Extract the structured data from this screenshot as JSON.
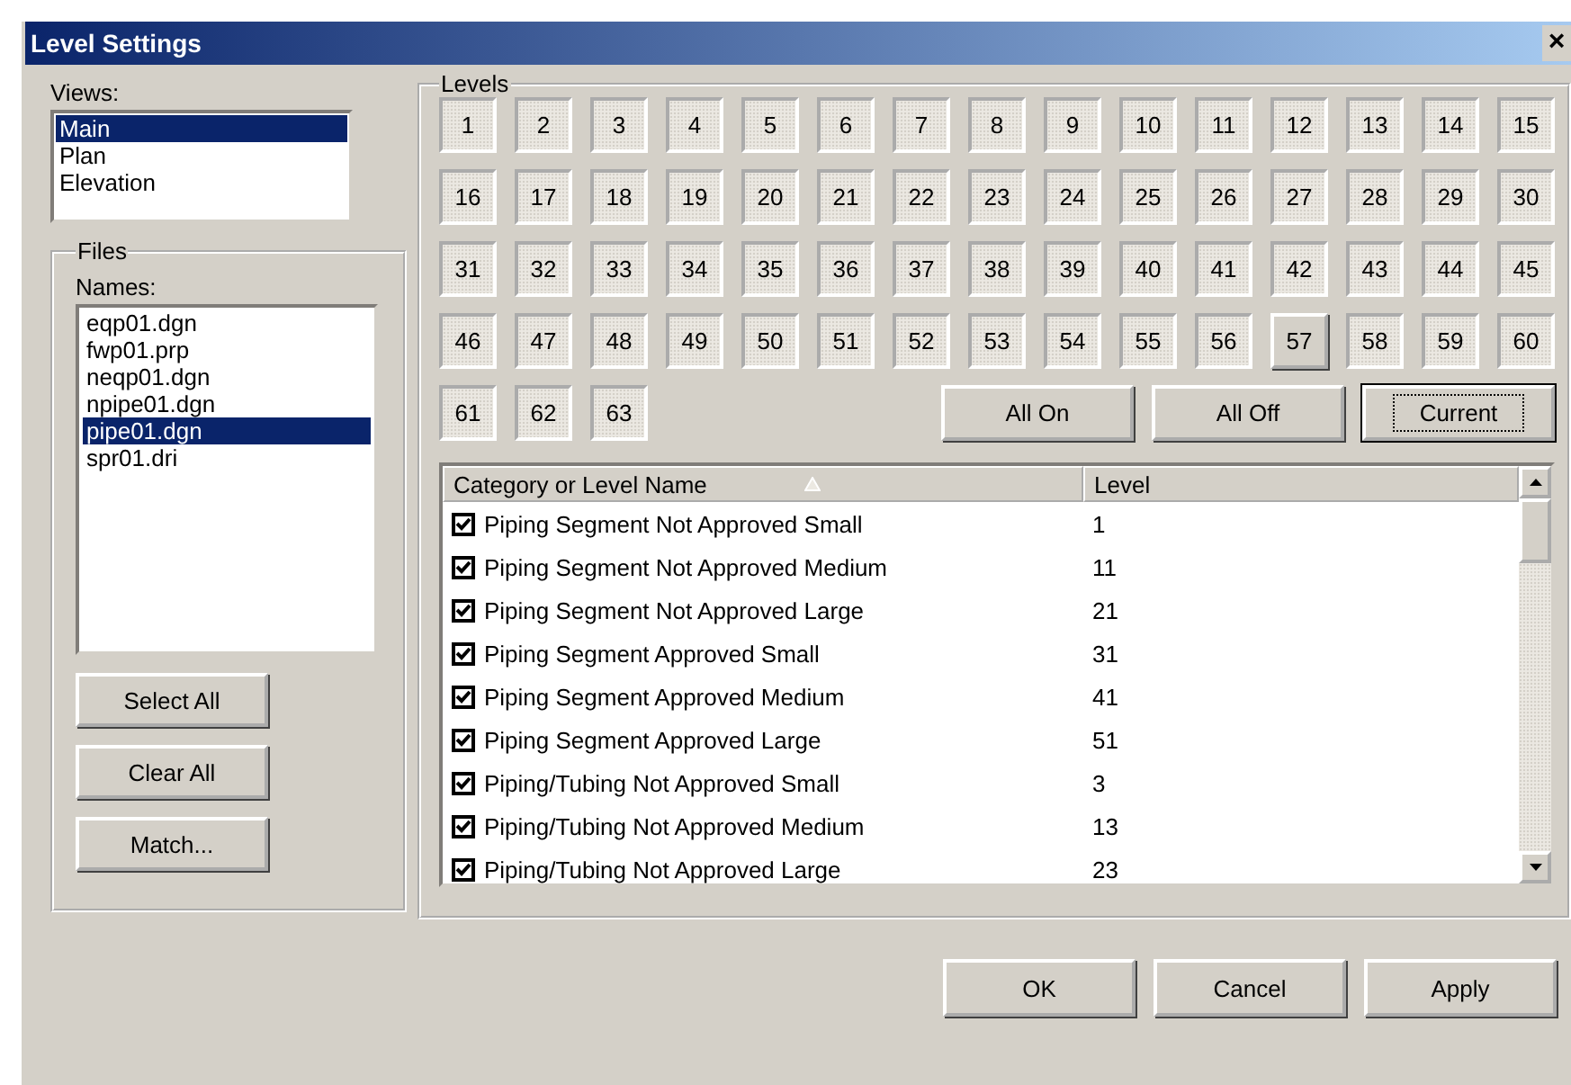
{
  "window": {
    "title": "Level Settings",
    "close": "×"
  },
  "views": {
    "label": "Views:",
    "items": [
      {
        "name": "Main",
        "selected": true
      },
      {
        "name": "Plan",
        "selected": false
      },
      {
        "name": "Elevation",
        "selected": false
      }
    ]
  },
  "files": {
    "title": "Files",
    "label": "Names:",
    "items": [
      {
        "name": "eqp01.dgn",
        "selected": false
      },
      {
        "name": "fwp01.prp",
        "selected": false
      },
      {
        "name": "neqp01.dgn",
        "selected": false
      },
      {
        "name": "npipe01.dgn",
        "selected": false
      },
      {
        "name": "pipe01.dgn",
        "selected": true
      },
      {
        "name": "spr01.dri",
        "selected": false
      }
    ],
    "buttons": [
      "Select All",
      "Clear All",
      "Match..."
    ]
  },
  "levels": {
    "title": "Levels",
    "buttons": [
      {
        "label": "1",
        "on": true
      },
      {
        "label": "2",
        "on": true
      },
      {
        "label": "3",
        "on": true
      },
      {
        "label": "4",
        "on": true
      },
      {
        "label": "5",
        "on": true
      },
      {
        "label": "6",
        "on": true
      },
      {
        "label": "7",
        "on": true
      },
      {
        "label": "8",
        "on": true
      },
      {
        "label": "9",
        "on": true
      },
      {
        "label": "10",
        "on": true
      },
      {
        "label": "11",
        "on": true
      },
      {
        "label": "12",
        "on": true
      },
      {
        "label": "13",
        "on": true
      },
      {
        "label": "14",
        "on": true
      },
      {
        "label": "15",
        "on": true
      },
      {
        "label": "16",
        "on": true
      },
      {
        "label": "17",
        "on": true
      },
      {
        "label": "18",
        "on": true
      },
      {
        "label": "19",
        "on": true
      },
      {
        "label": "20",
        "on": true
      },
      {
        "label": "21",
        "on": true
      },
      {
        "label": "22",
        "on": true
      },
      {
        "label": "23",
        "on": true
      },
      {
        "label": "24",
        "on": true
      },
      {
        "label": "25",
        "on": true
      },
      {
        "label": "26",
        "on": true
      },
      {
        "label": "27",
        "on": true
      },
      {
        "label": "28",
        "on": true
      },
      {
        "label": "29",
        "on": true
      },
      {
        "label": "30",
        "on": true
      },
      {
        "label": "31",
        "on": true
      },
      {
        "label": "32",
        "on": true
      },
      {
        "label": "33",
        "on": true
      },
      {
        "label": "34",
        "on": true
      },
      {
        "label": "35",
        "on": true
      },
      {
        "label": "36",
        "on": true
      },
      {
        "label": "37",
        "on": true
      },
      {
        "label": "38",
        "on": true
      },
      {
        "label": "39",
        "on": true
      },
      {
        "label": "40",
        "on": true
      },
      {
        "label": "41",
        "on": true
      },
      {
        "label": "42",
        "on": true
      },
      {
        "label": "43",
        "on": true
      },
      {
        "label": "44",
        "on": true
      },
      {
        "label": "45",
        "on": true
      },
      {
        "label": "46",
        "on": true
      },
      {
        "label": "47",
        "on": true
      },
      {
        "label": "48",
        "on": true
      },
      {
        "label": "49",
        "on": true
      },
      {
        "label": "50",
        "on": true
      },
      {
        "label": "51",
        "on": true
      },
      {
        "label": "52",
        "on": true
      },
      {
        "label": "53",
        "on": true
      },
      {
        "label": "54",
        "on": true
      },
      {
        "label": "55",
        "on": true
      },
      {
        "label": "56",
        "on": true
      },
      {
        "label": "57",
        "on": false
      },
      {
        "label": "58",
        "on": true
      },
      {
        "label": "59",
        "on": true
      },
      {
        "label": "60",
        "on": true
      },
      {
        "label": "61",
        "on": true
      },
      {
        "label": "62",
        "on": true
      },
      {
        "label": "63",
        "on": true
      }
    ],
    "actions": [
      {
        "label": "All On",
        "focused": false
      },
      {
        "label": "All Off",
        "focused": false
      },
      {
        "label": "Current",
        "focused": true
      }
    ]
  },
  "table": {
    "columns": [
      "Category or Level Name",
      "Level"
    ],
    "rows": [
      {
        "name": "Piping Segment Not Approved Small",
        "level_no": "1",
        "checked": true
      },
      {
        "name": "Piping Segment Not Approved Medium",
        "level_no": "11",
        "checked": true
      },
      {
        "name": "Piping Segment Not Approved Large",
        "level_no": "21",
        "checked": true
      },
      {
        "name": "Piping Segment Approved Small",
        "level_no": "31",
        "checked": true
      },
      {
        "name": "Piping Segment Approved Medium",
        "level_no": "41",
        "checked": true
      },
      {
        "name": "Piping Segment Approved Large",
        "level_no": "51",
        "checked": true
      },
      {
        "name": "Piping/Tubing Not Approved Small",
        "level_no": "3",
        "checked": true
      },
      {
        "name": "Piping/Tubing Not Approved Medium",
        "level_no": "13",
        "checked": true
      },
      {
        "name": "Piping/Tubing Not Approved Large",
        "level_no": "23",
        "checked": true
      }
    ]
  },
  "buttons": [
    "OK",
    "Cancel",
    "Apply"
  ]
}
